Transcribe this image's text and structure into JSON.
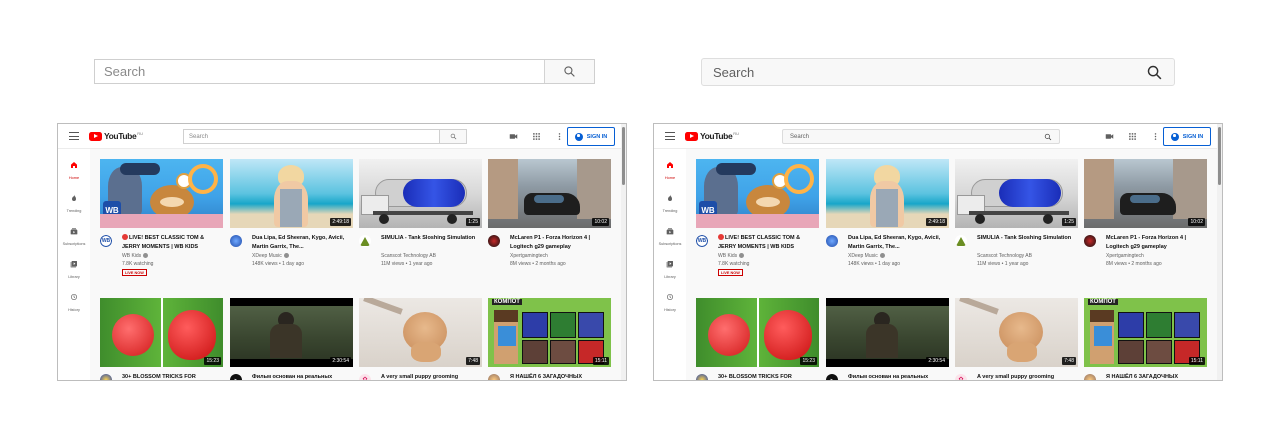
{
  "large_search_variants": [
    {
      "placeholder": "Search"
    },
    {
      "placeholder": "Search"
    }
  ],
  "header": {
    "logo_text": "YouTube",
    "region": "RU",
    "search_placeholder": "Search",
    "sign_in": "SIGN IN",
    "icons": [
      "menu-icon",
      "video-camera-icon",
      "apps-grid-icon",
      "more-vert-icon"
    ]
  },
  "sidebar": [
    {
      "label": "Home",
      "icon": "home-icon",
      "active": true
    },
    {
      "label": "Trending",
      "icon": "fire-icon",
      "active": false
    },
    {
      "label": "Subscriptions",
      "icon": "subscriptions-icon",
      "active": false
    },
    {
      "label": "Library",
      "icon": "library-icon",
      "active": false
    },
    {
      "label": "History",
      "icon": "history-icon",
      "active": false
    }
  ],
  "videos": [
    {
      "title": "LIVE! BEST CLASSIC TOM & JERRY MOMENTS | WB KIDS",
      "channel": "WB Kids",
      "stats": "7.8K watching",
      "duration": "",
      "live_label": "LIVE NOW",
      "verified": true
    },
    {
      "title": "Dua Lipa, Ed Sheeran, Kygo, Avicii, Martin Garrix, The...",
      "channel": "XDeep Music",
      "stats": "148K views • 1 day ago",
      "duration": "2:49:18",
      "verified": true
    },
    {
      "title": "SIMULIA - Tank Sloshing Simulation",
      "channel": "Scanscot Technology AB",
      "stats": "11M views • 1 year ago",
      "duration": "1:25",
      "verified": false
    },
    {
      "title": "McLaren P1 - Forza Horizon 4 | Logitech g29 gameplay",
      "channel": "Xpertgamingtech",
      "stats": "8M views • 2 months ago",
      "duration": "10:02",
      "verified": false
    },
    {
      "title": "30+ BLOSSOM TRICKS FOR",
      "duration": "15:23"
    },
    {
      "title": "Фильм основан на реальных",
      "duration": "2:30:54"
    },
    {
      "title": "A very small puppy grooming",
      "duration": "7:48"
    },
    {
      "title": "Я НАШЁЛ 6 ЗАГАДОЧНЫХ",
      "duration": "15:11",
      "thumb_text": "КОМПОТ"
    }
  ],
  "colors": {
    "brand_red": "#ff0000",
    "link_blue": "#065fd4",
    "live_red": "#cc0000"
  }
}
